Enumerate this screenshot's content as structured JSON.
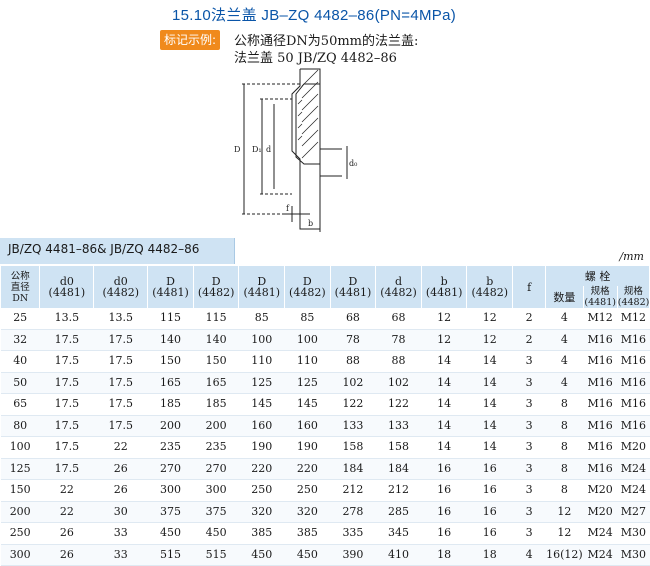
{
  "title": {
    "number": "15.10",
    "name": "法兰盖",
    "standard": "JB–ZQ 4482–86",
    "pressure": "(PN=4MPa)"
  },
  "marking": {
    "tag": "标记示例:",
    "line1": "公称通径DN为50mm的法兰盖:",
    "line2": "法兰盖 50 JB/ZQ 4482–86"
  },
  "drawing": {
    "labels": {
      "D": "D",
      "D1": "D₁",
      "d": "d",
      "d0": "d₀",
      "f": "f",
      "b": "b"
    }
  },
  "table_caption": "JB/ZQ 4481–86& JB/ZQ 4482–86",
  "unit": "/mm",
  "table": {
    "headers": {
      "dn": [
        "公称",
        "直径",
        "DN"
      ],
      "cols": [
        {
          "sym": "d0",
          "std": "(4481)"
        },
        {
          "sym": "d0",
          "std": "(4482)"
        },
        {
          "sym": "D",
          "std": "(4481)"
        },
        {
          "sym": "D",
          "std": "(4482)"
        },
        {
          "sym": "D",
          "std": "(4481)"
        },
        {
          "sym": "D",
          "std": "(4482)"
        },
        {
          "sym": "D",
          "std": "(4481)"
        },
        {
          "sym": "d",
          "std": "(4482)"
        },
        {
          "sym": "b",
          "std": "(4481)"
        },
        {
          "sym": "b",
          "std": "(4482)"
        }
      ],
      "f": "f",
      "bolt": "螺 栓",
      "bolt_qty": "数量",
      "bolt_spec_4481": [
        "规格",
        "(4481)"
      ],
      "bolt_spec_4482": [
        "规格",
        "(4482)"
      ]
    },
    "rows": [
      [
        "25",
        "13.5",
        "13.5",
        "115",
        "115",
        "85",
        "85",
        "68",
        "68",
        "12",
        "12",
        "2",
        "4",
        "M12",
        "M12"
      ],
      [
        "32",
        "17.5",
        "17.5",
        "140",
        "140",
        "100",
        "100",
        "78",
        "78",
        "12",
        "12",
        "2",
        "4",
        "M16",
        "M16"
      ],
      [
        "40",
        "17.5",
        "17.5",
        "150",
        "150",
        "110",
        "110",
        "88",
        "88",
        "14",
        "14",
        "3",
        "4",
        "M16",
        "M16"
      ],
      [
        "50",
        "17.5",
        "17.5",
        "165",
        "165",
        "125",
        "125",
        "102",
        "102",
        "14",
        "14",
        "3",
        "4",
        "M16",
        "M16"
      ],
      [
        "65",
        "17.5",
        "17.5",
        "185",
        "185",
        "145",
        "145",
        "122",
        "122",
        "14",
        "14",
        "3",
        "8",
        "M16",
        "M16"
      ],
      [
        "80",
        "17.5",
        "17.5",
        "200",
        "200",
        "160",
        "160",
        "133",
        "133",
        "14",
        "14",
        "3",
        "8",
        "M16",
        "M16"
      ],
      [
        "100",
        "17.5",
        "22",
        "235",
        "235",
        "190",
        "190",
        "158",
        "158",
        "14",
        "14",
        "3",
        "8",
        "M16",
        "M20"
      ],
      [
        "125",
        "17.5",
        "26",
        "270",
        "270",
        "220",
        "220",
        "184",
        "184",
        "16",
        "16",
        "3",
        "8",
        "M16",
        "M24"
      ],
      [
        "150",
        "22",
        "26",
        "300",
        "300",
        "250",
        "250",
        "212",
        "212",
        "16",
        "16",
        "3",
        "8",
        "M20",
        "M24"
      ],
      [
        "200",
        "22",
        "30",
        "375",
        "375",
        "320",
        "320",
        "278",
        "285",
        "16",
        "16",
        "3",
        "12",
        "M20",
        "M27"
      ],
      [
        "250",
        "26",
        "33",
        "450",
        "450",
        "385",
        "385",
        "335",
        "345",
        "16",
        "16",
        "3",
        "12",
        "M24",
        "M30"
      ],
      [
        "300",
        "26",
        "33",
        "515",
        "515",
        "450",
        "450",
        "390",
        "410",
        "18",
        "18",
        "4",
        "16(12)",
        "M24",
        "M30"
      ]
    ]
  }
}
